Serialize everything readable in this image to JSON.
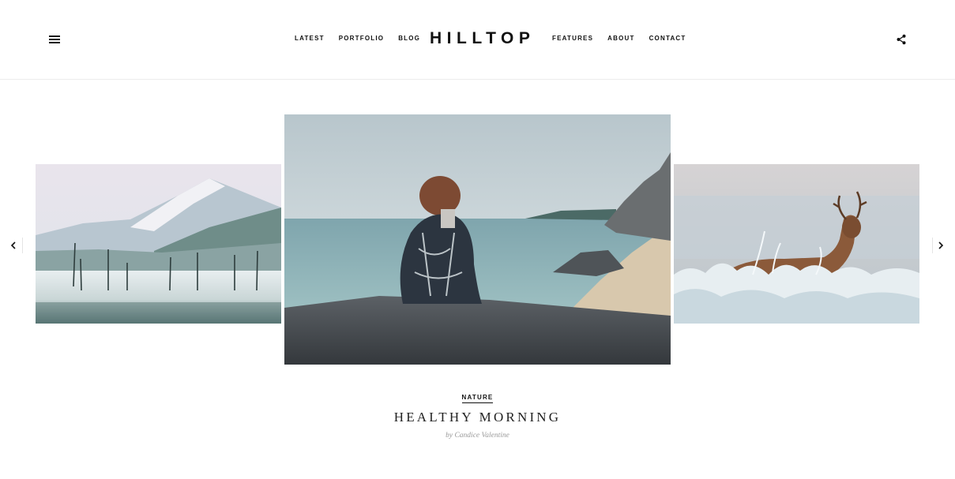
{
  "header": {
    "logo": "HILLTOP",
    "nav_left": [
      {
        "label": "LATEST"
      },
      {
        "label": "PORTFOLIO"
      },
      {
        "label": "BLOG"
      }
    ],
    "nav_right": [
      {
        "label": "FEATURES"
      },
      {
        "label": "ABOUT"
      },
      {
        "label": "CONTACT"
      }
    ],
    "menu_icon": "hamburger-icon",
    "share_icon": "share-icon"
  },
  "slider": {
    "slides": [
      {
        "image": "misty-mountain-forest"
      },
      {
        "image": "woman-sitting-on-rock-by-beach"
      },
      {
        "image": "deer-in-frosty-field"
      }
    ],
    "prev_icon": "chevron-left-icon",
    "next_icon": "chevron-right-icon"
  },
  "post": {
    "category": "NATURE",
    "title": "HEALTHY MORNING",
    "byline": "by Candice Valentine"
  },
  "colors": {
    "text": "#111111",
    "byline": "#9a9a9a",
    "divider": "#ececec"
  }
}
